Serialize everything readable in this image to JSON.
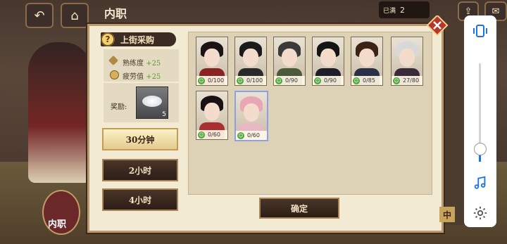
{
  "header": {
    "title": "内职",
    "resource": {
      "label": "已满",
      "value": "2"
    }
  },
  "panel": {
    "task_title": "上街采购",
    "help_icon": "question-icon",
    "stats": [
      {
        "label": "熟练度",
        "value": "+25",
        "icon": "proficiency-icon"
      },
      {
        "label": "疲劳值",
        "value": "+25",
        "icon": "fatigue-icon"
      }
    ],
    "reward_label": "奖励:",
    "reward_item": {
      "icon": "salt-icon",
      "count": "5"
    },
    "durations": [
      {
        "label": "30分钟",
        "selected": true
      },
      {
        "label": "2小时",
        "selected": false
      },
      {
        "label": "4小时",
        "selected": false
      }
    ],
    "confirm_label": "确定",
    "characters": [
      {
        "fatigue": "0/100",
        "hair": "#1c1414",
        "body": "#8a2323",
        "selected": false
      },
      {
        "fatigue": "0/100",
        "hair": "#1b1a1a",
        "body": "#2a2a2a",
        "selected": false
      },
      {
        "fatigue": "0/90",
        "hair": "#3a3a3a",
        "body": "#4a5a3a",
        "selected": false
      },
      {
        "fatigue": "0/90",
        "hair": "#141414",
        "body": "#1e1e2a",
        "selected": false
      },
      {
        "fatigue": "0/85",
        "hair": "#3b2416",
        "body": "#2a3048",
        "selected": false
      },
      {
        "fatigue": "27/80",
        "hair": "#d8d8d8",
        "body": "#3a2a3a",
        "selected": false
      },
      {
        "fatigue": "0/60",
        "hair": "#1a1212",
        "body": "#a83030",
        "selected": false
      },
      {
        "fatigue": "0/60",
        "hair": "#e7a7b4",
        "body": "#e7b7c4",
        "selected": true
      }
    ]
  },
  "left_tab": {
    "label": "内职"
  },
  "stamp": "中",
  "colors": {
    "accent": "#a88558",
    "fatigue_ok": "#4ea63a"
  }
}
